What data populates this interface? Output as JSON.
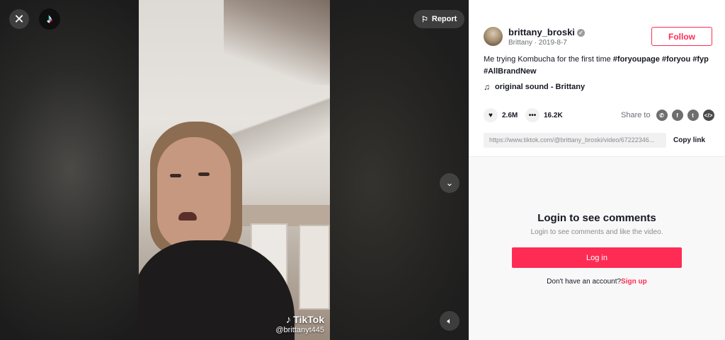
{
  "player": {
    "close_icon": "close-icon",
    "logo_icon": "tiktok-logo-icon",
    "logo_glyph": "♪",
    "report_label": "Report",
    "watermark_brand": "TikTok",
    "watermark_user": "@brittanyt445"
  },
  "author": {
    "username": "brittany_broski",
    "display_name": "Brittany",
    "date": "2019-8-7",
    "follow_label": "Follow"
  },
  "post": {
    "caption_text": "Me trying Kombucha for the first time ",
    "hashtags": [
      "#foryoupage",
      "#foryou",
      "#fyp",
      "#AllBrandNew"
    ],
    "music": "original sound - Brittany"
  },
  "stats": {
    "likes": "2.6M",
    "comments": "16.2K"
  },
  "share": {
    "label": "Share to",
    "link": "https://www.tiktok.com/@brittany_broski/video/67222346...",
    "copy_label": "Copy link"
  },
  "comments_section": {
    "title": "Login to see comments",
    "subtitle": "Login to see comments and like the video.",
    "login_label": "Log in",
    "no_account_text": "Don't have an account?",
    "signup_label": "Sign up"
  },
  "colors": {
    "accent": "#fe2c55",
    "text": "#161823",
    "muted": "#8a8b91"
  }
}
